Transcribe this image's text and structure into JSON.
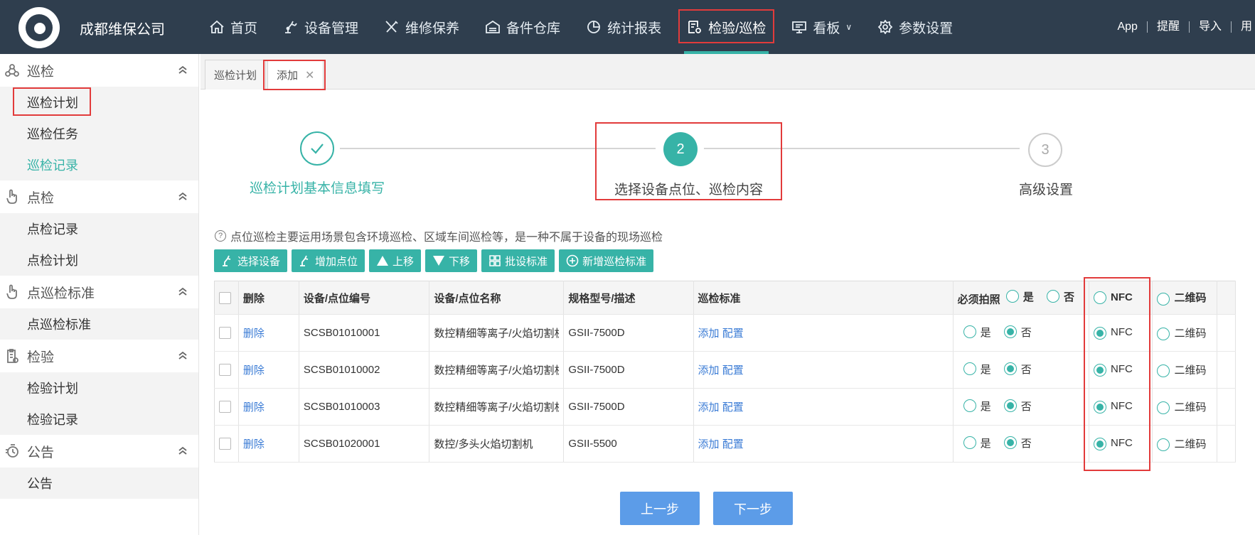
{
  "header": {
    "company": "成都维保公司",
    "nav": [
      {
        "label": "首页",
        "icon": "home-icon"
      },
      {
        "label": "设备管理",
        "icon": "robot-arm-icon"
      },
      {
        "label": "维修保养",
        "icon": "tools-icon"
      },
      {
        "label": "备件仓库",
        "icon": "warehouse-icon"
      },
      {
        "label": "统计报表",
        "icon": "pie-chart-icon"
      },
      {
        "label": "检验/巡检",
        "icon": "inspection-icon",
        "active": true
      },
      {
        "label": "看板",
        "icon": "board-icon",
        "dropdown": true
      },
      {
        "label": "参数设置",
        "icon": "gear-icon"
      }
    ],
    "right_links": [
      "App",
      "提醒",
      "导入",
      "用"
    ]
  },
  "sidebar": {
    "groups": [
      {
        "label": "巡检",
        "icon": "inspection-route-icon",
        "items": [
          {
            "label": "巡检计划",
            "highlighted": true
          },
          {
            "label": "巡检任务"
          },
          {
            "label": "巡检记录",
            "active": true
          }
        ]
      },
      {
        "label": "点检",
        "icon": "pointer-hand-icon",
        "items": [
          {
            "label": "点检记录"
          },
          {
            "label": "点检计划"
          }
        ]
      },
      {
        "label": "点巡检标准",
        "icon": "pointer-hand-icon",
        "items": [
          {
            "label": "点巡检标准"
          }
        ]
      },
      {
        "label": "检验",
        "icon": "clipboard-icon",
        "items": [
          {
            "label": "检验计划"
          },
          {
            "label": "检验记录"
          }
        ]
      },
      {
        "label": "公告",
        "icon": "timer-icon",
        "items": [
          {
            "label": "公告"
          }
        ]
      }
    ]
  },
  "tabs": [
    {
      "label": "巡检计划"
    },
    {
      "label": "添加",
      "closable": true,
      "active": true
    }
  ],
  "steps": [
    {
      "label": "巡检计划基本信息填写",
      "state": "done"
    },
    {
      "number": "2",
      "label": "选择设备点位、巡检内容",
      "state": "current"
    },
    {
      "number": "3",
      "label": "高级设置",
      "state": "todo"
    }
  ],
  "hint": "点位巡检主要运用场景包含环境巡检、区域车间巡检等，是一种不属于设备的现场巡检",
  "toolbar": [
    "选择设备",
    "增加点位",
    "上移",
    "下移",
    "批设标准",
    "新增巡检标准"
  ],
  "table": {
    "headers": {
      "delete": "删除",
      "code": "设备/点位编号",
      "name": "设备/点位名称",
      "spec": "规格型号/描述",
      "standard": "巡检标准",
      "photo": "必须拍照",
      "yes": "是",
      "no": "否",
      "nfc": "NFC",
      "qr": "二维码"
    },
    "rows": [
      {
        "delete": "删除",
        "code": "SCSB01010001",
        "name": "数控精细等离子/火焰切割机",
        "spec": "GSII-7500D",
        "add": "添加",
        "config": "配置",
        "yes": "是",
        "no": "否",
        "photo": "no",
        "nfc": "NFC",
        "qr": "二维码",
        "scan": "nfc"
      },
      {
        "delete": "删除",
        "code": "SCSB01010002",
        "name": "数控精细等离子/火焰切割机",
        "spec": "GSII-7500D",
        "add": "添加",
        "config": "配置",
        "yes": "是",
        "no": "否",
        "photo": "no",
        "nfc": "NFC",
        "qr": "二维码",
        "scan": "nfc"
      },
      {
        "delete": "删除",
        "code": "SCSB01010003",
        "name": "数控精细等离子/火焰切割机",
        "spec": "GSII-7500D",
        "add": "添加",
        "config": "配置",
        "yes": "是",
        "no": "否",
        "photo": "no",
        "nfc": "NFC",
        "qr": "二维码",
        "scan": "nfc"
      },
      {
        "delete": "删除",
        "code": "SCSB01020001",
        "name": "数控/多头火焰切割机",
        "spec": "GSII-5500",
        "add": "添加",
        "config": "配置",
        "yes": "是",
        "no": "否",
        "photo": "no",
        "nfc": "NFC",
        "qr": "二维码",
        "scan": "nfc"
      }
    ]
  },
  "buttons": {
    "prev": "上一步",
    "next": "下一步"
  },
  "colors": {
    "header_bg": "#2f3e4e",
    "accent": "#37b3a7",
    "highlight": "#e23b3b",
    "primary_button": "#5c9ce8",
    "link": "#3a7bd5"
  }
}
